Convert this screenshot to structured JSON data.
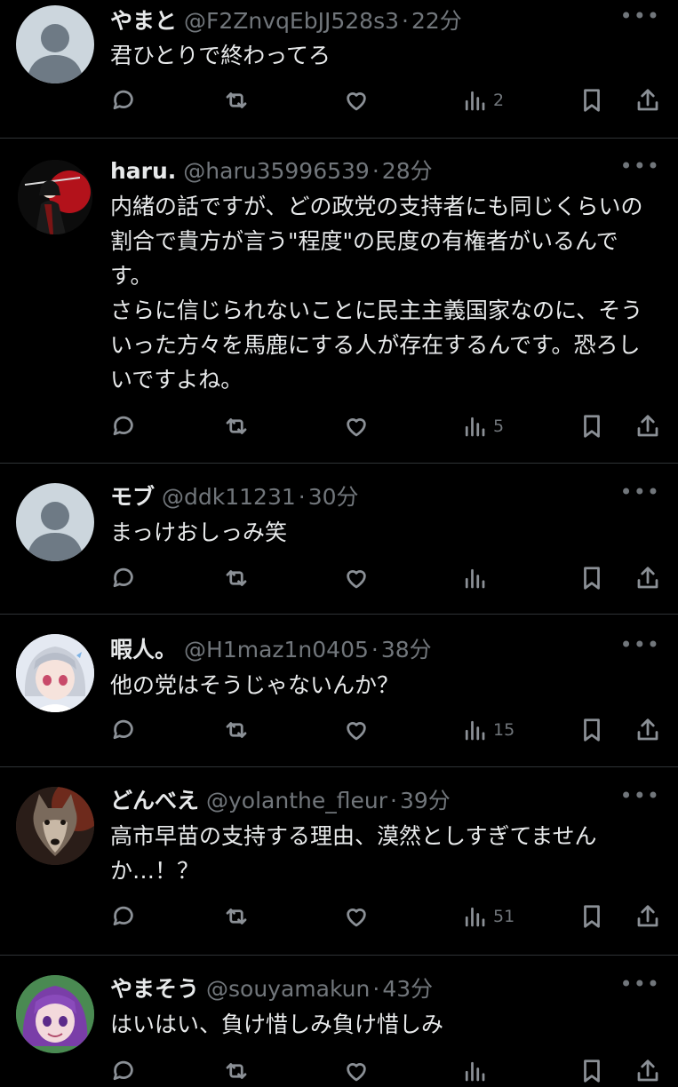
{
  "tweets": [
    {
      "name": "やまと",
      "handle": "@F2ZnvqEbJJ528s3",
      "sep": "·",
      "time": "22分",
      "text": "君ひとりで終わってろ",
      "views": "2",
      "avatar": "default"
    },
    {
      "name": "haru.",
      "handle": "@haru35996539",
      "sep": "·",
      "time": "28分",
      "text": "内緒の話ですが、どの政党の支持者にも同じくらいの割合で貴方が言う\"程度\"の民度の有権者がいるんです。\nさらに信じられないことに民主主義国家なのに、そういった方々を馬鹿にする人が存在するんです。恐ろしいですよね。",
      "views": "5",
      "avatar": "red-sun"
    },
    {
      "name": "モブ",
      "handle": "@ddk11231",
      "sep": "·",
      "time": "30分",
      "text": "まっけおしっみ笑",
      "views": "",
      "avatar": "default"
    },
    {
      "name": "暇人。",
      "handle": "@H1maz1n0405",
      "sep": "·",
      "time": "38分",
      "text": "他の党はそうじゃないんか？",
      "views": "15",
      "avatar": "anime-girl"
    },
    {
      "name": "どんべえ",
      "handle": "@yolanthe_fleur",
      "sep": "·",
      "time": "39分",
      "text": "高市早苗の支持する理由、漠然としすぎてませんか…！？",
      "views": "51",
      "avatar": "wolf"
    },
    {
      "name": "やまそう",
      "handle": "@souyamakun",
      "sep": "·",
      "time": "43分",
      "text": "はいはい、負け惜しみ負け惜しみ",
      "views": "",
      "avatar": "anime-purple"
    }
  ],
  "icons": {
    "reply": "reply-icon",
    "retweet": "retweet-icon",
    "like": "like-icon",
    "views": "views-icon",
    "bookmark": "bookmark-icon",
    "share": "share-icon",
    "more": "more-icon"
  },
  "colors": {
    "background": "#000000",
    "text": "#e7e9ea",
    "secondary": "#71767b",
    "divider": "#2f3336"
  }
}
